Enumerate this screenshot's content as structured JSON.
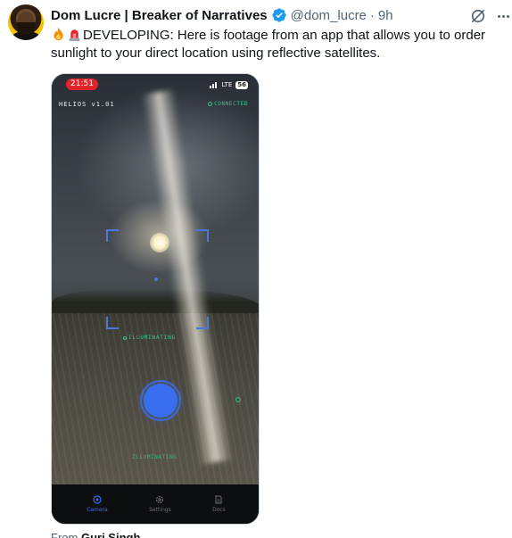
{
  "tweet": {
    "display_name": "Dom Lucre | Breaker of Narratives",
    "handle": "@dom_lucre",
    "separator": "·",
    "time": "9h",
    "text": "DEVELOPING: Here is footage from an app that allows you to order sunlight to your direct location using reflective satellites.",
    "emojis": [
      "fire-emoji",
      "rotating-light-emoji"
    ]
  },
  "media": {
    "phone_time": "21:51",
    "network": "LTE",
    "battery": "56",
    "app_title": "HELIOS v1.01",
    "connected_label": "CONNECTED",
    "target_label": "ILLUMINATING",
    "status_label": "ILLUMINATING",
    "nav": [
      {
        "label": "Camera",
        "icon": "camera-icon",
        "active": true
      },
      {
        "label": "Settings",
        "icon": "settings-icon",
        "active": false
      },
      {
        "label": "Docs",
        "icon": "docs-icon",
        "active": false
      }
    ]
  },
  "quote_from": {
    "prefix": "From",
    "name": "Guri Singh"
  },
  "colors": {
    "accent": "#1d9bf0",
    "app_green": "#2fcc8a",
    "app_blue": "#3a6ef0"
  }
}
